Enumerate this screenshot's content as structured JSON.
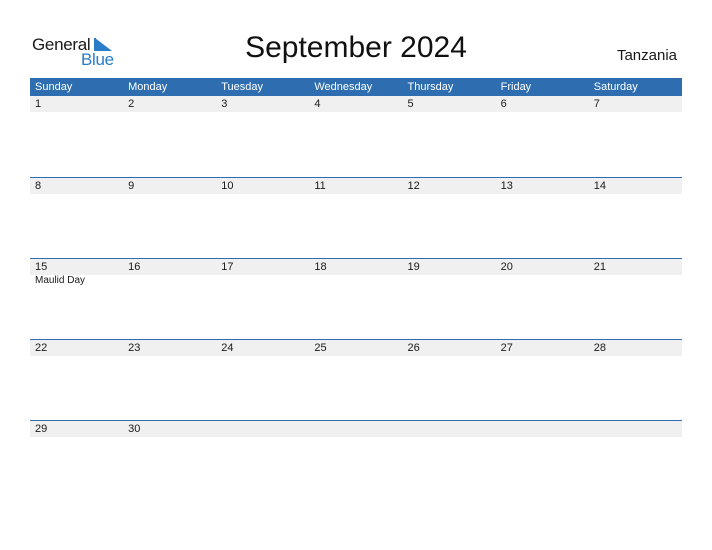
{
  "logo": {
    "line1": "General",
    "line2": "Blue",
    "brand_color": "#2a7bc8",
    "icon": "triangle-flag-icon"
  },
  "title": "September 2024",
  "country": "Tanzania",
  "colors": {
    "header_bg": "#2e6eb0",
    "day_strip_bg": "#f0f0f0"
  },
  "weekdays": [
    "Sunday",
    "Monday",
    "Tuesday",
    "Wednesday",
    "Thursday",
    "Friday",
    "Saturday"
  ],
  "weeks": [
    {
      "days": [
        "1",
        "2",
        "3",
        "4",
        "5",
        "6",
        "7"
      ],
      "events": [
        "",
        "",
        "",
        "",
        "",
        "",
        ""
      ]
    },
    {
      "days": [
        "8",
        "9",
        "10",
        "11",
        "12",
        "13",
        "14"
      ],
      "events": [
        "",
        "",
        "",
        "",
        "",
        "",
        ""
      ]
    },
    {
      "days": [
        "15",
        "16",
        "17",
        "18",
        "19",
        "20",
        "21"
      ],
      "events": [
        "Maulid Day",
        "",
        "",
        "",
        "",
        "",
        ""
      ]
    },
    {
      "days": [
        "22",
        "23",
        "24",
        "25",
        "26",
        "27",
        "28"
      ],
      "events": [
        "",
        "",
        "",
        "",
        "",
        "",
        ""
      ]
    },
    {
      "days": [
        "29",
        "30",
        "",
        "",
        "",
        "",
        ""
      ],
      "events": [
        "",
        "",
        "",
        "",
        "",
        "",
        ""
      ]
    }
  ]
}
